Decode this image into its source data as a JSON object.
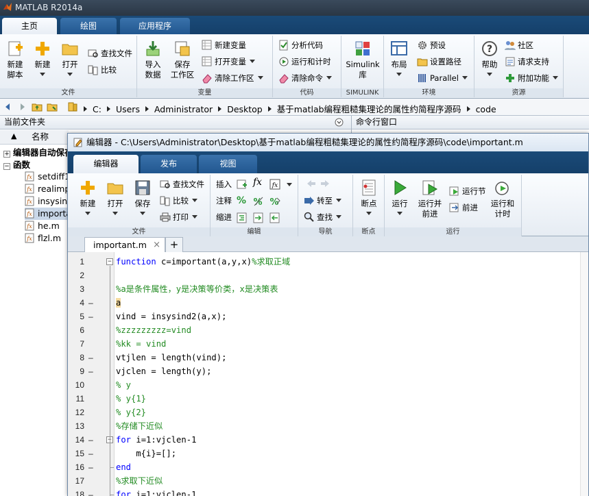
{
  "window": {
    "title": "MATLAB R2014a"
  },
  "main_tabs": [
    {
      "label": "主页"
    },
    {
      "label": "绘图"
    },
    {
      "label": "应用程序"
    }
  ],
  "ribbon": {
    "new_script": "新建\n脚本",
    "new": "新建",
    "open": "打开",
    "find_files": "查找文件",
    "compare": "比较",
    "import_data": "导入\n数据",
    "save_workspace": "保存\n工作区",
    "new_variable": "新建变量",
    "open_variable": "打开变量",
    "clear_workspace": "清除工作区",
    "analyze_code": "分析代码",
    "run_and_time": "运行和计时",
    "clear_commands": "清除命令",
    "simulink": "Simulink\n库",
    "layout": "布局",
    "preferences": "预设",
    "set_path": "设置路径",
    "parallel": "Parallel",
    "help": "帮助",
    "community": "社区",
    "request_support": "请求支持",
    "addons": "附加功能",
    "group_labels": {
      "file": "文件",
      "variable": "变量",
      "code": "代码",
      "simulink": "SIMULINK",
      "environment": "环境",
      "resources": "资源"
    }
  },
  "address": {
    "path": [
      "C:",
      "Users",
      "Administrator",
      "Desktop",
      "基于matlab编程粗糙集理论的属性约简程序源码",
      "code"
    ]
  },
  "current_folder": {
    "title": "当前文件夹",
    "column_name": "名称",
    "sort_indicator": "▲",
    "tree": [
      {
        "label": "编辑器自动保存"
      },
      {
        "label": "函数"
      }
    ],
    "files": [
      {
        "name": "setdiff1"
      },
      {
        "name": "realimp"
      },
      {
        "name": "insysind"
      },
      {
        "name": "important.m"
      },
      {
        "name": "he.m"
      },
      {
        "name": "flzl.m"
      }
    ]
  },
  "command_window": {
    "title": "命令行窗口"
  },
  "editor": {
    "title": "编辑器 - C:\\Users\\Administrator\\Desktop\\基于matlab编程粗糙集理论的属性约简程序源码\\code\\important.m",
    "tabs": [
      {
        "label": "编辑器"
      },
      {
        "label": "发布"
      },
      {
        "label": "视图"
      }
    ],
    "ribbon": {
      "new": "新建",
      "open": "打开",
      "save": "保存",
      "find_files": "查找文件",
      "compare": "比较",
      "print": "打印",
      "insert": "插入",
      "comment": "注释",
      "indent": "缩进",
      "goto": "转至",
      "find": "查找",
      "breakpoints": "断点",
      "run": "运行",
      "run_advance": "运行并\n前进",
      "run_section": "运行节",
      "advance": "前进",
      "run_and_time": "运行和\n计时",
      "fx_glyph": "fx",
      "pct_glyph": "%",
      "group_labels": {
        "file": "文件",
        "edit": "编辑",
        "navigate": "导航",
        "breakpoints": "断点",
        "run": "运行"
      }
    },
    "doc_tab": {
      "label": "important.m",
      "close": "×",
      "add": "+"
    },
    "lines": [
      {
        "n": "1",
        "dash": "",
        "parts": [
          {
            "t": "function",
            "c": "kw"
          },
          {
            "t": " c=important(a,y,x)",
            "c": ""
          },
          {
            "t": "%求取正域",
            "c": "cm"
          }
        ]
      },
      {
        "n": "2",
        "dash": "",
        "parts": []
      },
      {
        "n": "3",
        "dash": "",
        "parts": [
          {
            "t": "%a是条件属性，y是决策等价类，x是决策表",
            "c": "cm"
          }
        ]
      },
      {
        "n": "4",
        "dash": "–",
        "parts": [
          {
            "t": "a",
            "c": "hl"
          }
        ]
      },
      {
        "n": "5",
        "dash": "–",
        "parts": [
          {
            "t": "vind = insysind2(a,x);",
            "c": ""
          }
        ]
      },
      {
        "n": "6",
        "dash": "",
        "parts": [
          {
            "t": "%zzzzzzzzz=vind",
            "c": "cm"
          }
        ]
      },
      {
        "n": "7",
        "dash": "",
        "parts": [
          {
            "t": "%kk = vind",
            "c": "cm"
          }
        ]
      },
      {
        "n": "8",
        "dash": "–",
        "parts": [
          {
            "t": "vtjlen = length(vind);",
            "c": ""
          }
        ]
      },
      {
        "n": "9",
        "dash": "–",
        "parts": [
          {
            "t": "vjclen = length(y);",
            "c": ""
          }
        ]
      },
      {
        "n": "10",
        "dash": "",
        "parts": [
          {
            "t": "% y",
            "c": "cm"
          }
        ]
      },
      {
        "n": "11",
        "dash": "",
        "parts": [
          {
            "t": "% y{1}",
            "c": "cm"
          }
        ]
      },
      {
        "n": "12",
        "dash": "",
        "parts": [
          {
            "t": "% y{2}",
            "c": "cm"
          }
        ]
      },
      {
        "n": "13",
        "dash": "",
        "parts": [
          {
            "t": "%存储下近似",
            "c": "cm"
          }
        ]
      },
      {
        "n": "14",
        "dash": "–",
        "parts": [
          {
            "t": "for",
            "c": "kw"
          },
          {
            "t": " i=1:vjclen-1",
            "c": ""
          }
        ]
      },
      {
        "n": "15",
        "dash": "–",
        "parts": [
          {
            "t": "    m{i}=[];",
            "c": ""
          }
        ]
      },
      {
        "n": "16",
        "dash": "–",
        "parts": [
          {
            "t": "end",
            "c": "kw"
          }
        ]
      },
      {
        "n": "17",
        "dash": "",
        "parts": [
          {
            "t": "%求取下近似",
            "c": "cm"
          }
        ]
      },
      {
        "n": "18",
        "dash": "–",
        "parts": [
          {
            "t": "for",
            "c": "kw"
          },
          {
            "t": " i=1:vjclen-1",
            "c": ""
          }
        ]
      }
    ]
  },
  "colors": {
    "ribbon_tab_bg": "#1a4a78",
    "keyword": "#0000ff",
    "comment": "#228b22"
  }
}
